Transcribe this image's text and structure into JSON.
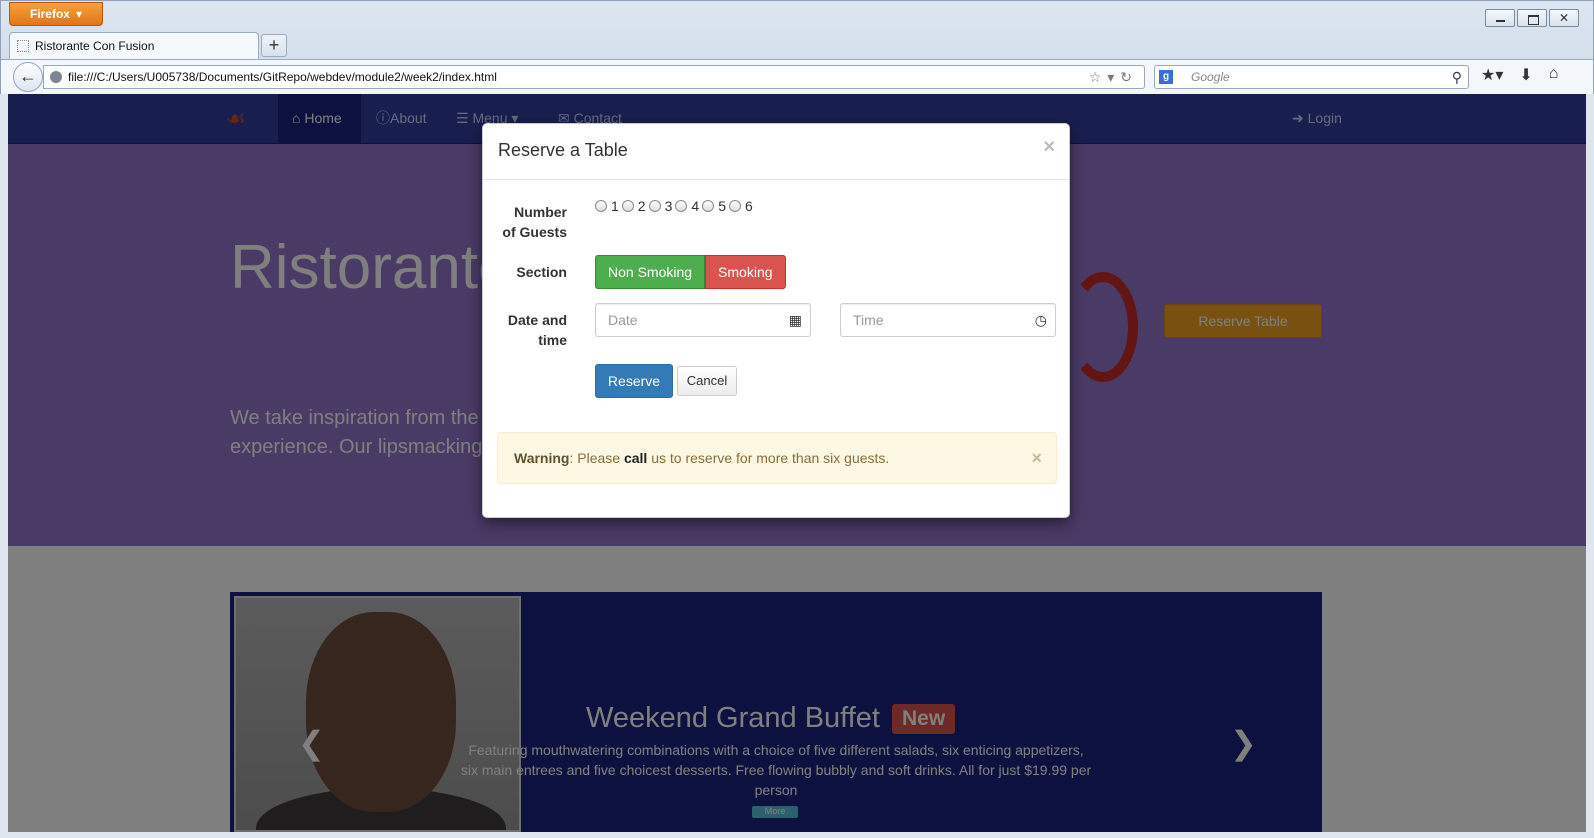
{
  "browser": {
    "app_button": "Firefox",
    "tab_title": "Ristorante Con Fusion",
    "url": "file:///C:/Users/U005738/Documents/GitRepo/webdev/module2/week2/index.html",
    "search_placeholder": "Google"
  },
  "site": {
    "nav": {
      "home": "Home",
      "about": "About",
      "menu": "Menu",
      "contact": "Contact",
      "login": "Login"
    },
    "jumbotron": {
      "heading": "Ristorante",
      "text_line1": "We take inspiration from the",
      "text_line2": "experience. Our lipsmacking",
      "reserve_button": "Reserve Table"
    },
    "carousel": {
      "title": "Weekend Grand Buffet",
      "badge": "New",
      "description": "Featuring mouthwatering combinations with a choice of five different salads, six enticing appetizers, six main entrees and five choicest desserts. Free flowing bubbly and soft drinks. All for just $19.99 per person",
      "more_button": "More"
    }
  },
  "modal": {
    "title": "Reserve a Table",
    "close": "×",
    "guests_label_line1": "Number",
    "guests_label_line2": "of Guests",
    "guest_options": [
      "1",
      "2",
      "3",
      "4",
      "5",
      "6"
    ],
    "section_label": "Section",
    "section_options": {
      "non_smoking": "Non Smoking",
      "smoking": "Smoking"
    },
    "datetime_label_line1": "Date and",
    "datetime_label_line2": "time",
    "date_placeholder": "Date",
    "time_placeholder": "Time",
    "reserve_button": "Reserve",
    "cancel_button": "Cancel",
    "alert": {
      "strong": "Warning",
      "text_before": ": Please ",
      "call": "call",
      "text_after": " us to reserve for more than six guests.",
      "close": "×"
    }
  },
  "colors": {
    "nav_bg": "#303f9f",
    "jumbotron_bg": "#9575cd",
    "carousel_bg": "#1a237e",
    "primary": "#337ab7",
    "success": "#4cae4c",
    "danger": "#d9534f",
    "warning_bg": "#fcf8e3"
  }
}
